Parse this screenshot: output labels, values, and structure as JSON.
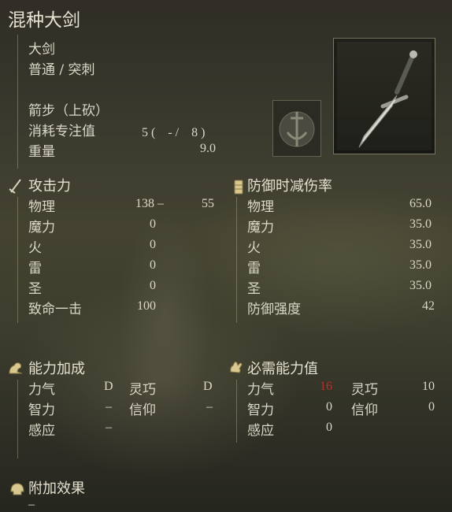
{
  "item": {
    "name": "混种大剑",
    "weapon_type": "大剑",
    "damage_type": "普通 / 突刺",
    "skill": "箭步（上砍）",
    "fp_label": "消耗专注值",
    "fp_value": "5 (　- /　8 )",
    "weight_label": "重量",
    "weight_value": "9.0"
  },
  "attack": {
    "header": "攻击力",
    "rows": [
      {
        "label": "物理",
        "value": "138 –",
        "value2": "55"
      },
      {
        "label": "魔力",
        "value": "0"
      },
      {
        "label": "火",
        "value": "0"
      },
      {
        "label": "雷",
        "value": "0"
      },
      {
        "label": "圣",
        "value": "0"
      },
      {
        "label": "致命一击",
        "value": "100"
      }
    ]
  },
  "guard": {
    "header": "防御时减伤率",
    "rows": [
      {
        "label": "物理",
        "value": "65.0"
      },
      {
        "label": "魔力",
        "value": "35.0"
      },
      {
        "label": "火",
        "value": "35.0"
      },
      {
        "label": "雷",
        "value": "35.0"
      },
      {
        "label": "圣",
        "value": "35.0"
      },
      {
        "label": "防御强度",
        "value": "42"
      }
    ]
  },
  "scaling": {
    "header": "能力加成",
    "rows": [
      {
        "l1": "力气",
        "v1": "D",
        "l2": "灵巧",
        "v2": "D"
      },
      {
        "l1": "智力",
        "v1": "–",
        "l2": "信仰",
        "v2": "–"
      },
      {
        "l1": "感应",
        "v1": "–"
      }
    ]
  },
  "requirements": {
    "header": "必需能力值",
    "rows": [
      {
        "l1": "力气",
        "v1": "16",
        "l2": "灵巧",
        "v2": "10"
      },
      {
        "l1": "智力",
        "v1": "0",
        "l2": "信仰",
        "v2": "0"
      },
      {
        "l1": "感应",
        "v1": "0"
      }
    ]
  },
  "passive": {
    "header": "附加效果",
    "value": "–"
  },
  "colors": {
    "text": "#dcd8c8",
    "insufficient_stat": "#b8322c",
    "background": "#3a3a2e"
  },
  "icons": {
    "weapon_image": "greatsword-image",
    "skill_icon": "ash-of-war-icon",
    "attack_icon": "sword-icon",
    "guard_icon": "shield-icon",
    "scaling_icon": "arm-icon",
    "requirements_icon": "hand-icon",
    "passive_icon": "helmet-icon"
  }
}
